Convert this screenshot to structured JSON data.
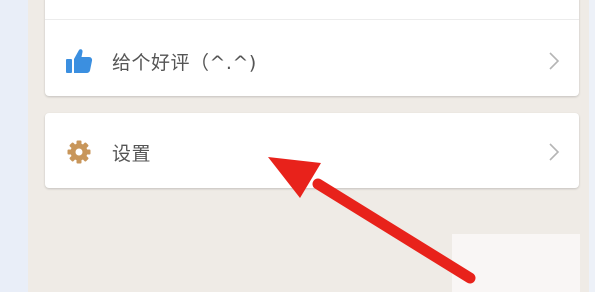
{
  "menu": {
    "rate_item": {
      "label": "给个好评（^.^)",
      "icon": "thumbs-up-icon",
      "icon_color": "#3b8fe0"
    },
    "settings_item": {
      "label": "设置",
      "icon": "gear-icon",
      "icon_color": "#c8965a"
    }
  },
  "annotation": {
    "arrow_color": "#e8221b"
  }
}
